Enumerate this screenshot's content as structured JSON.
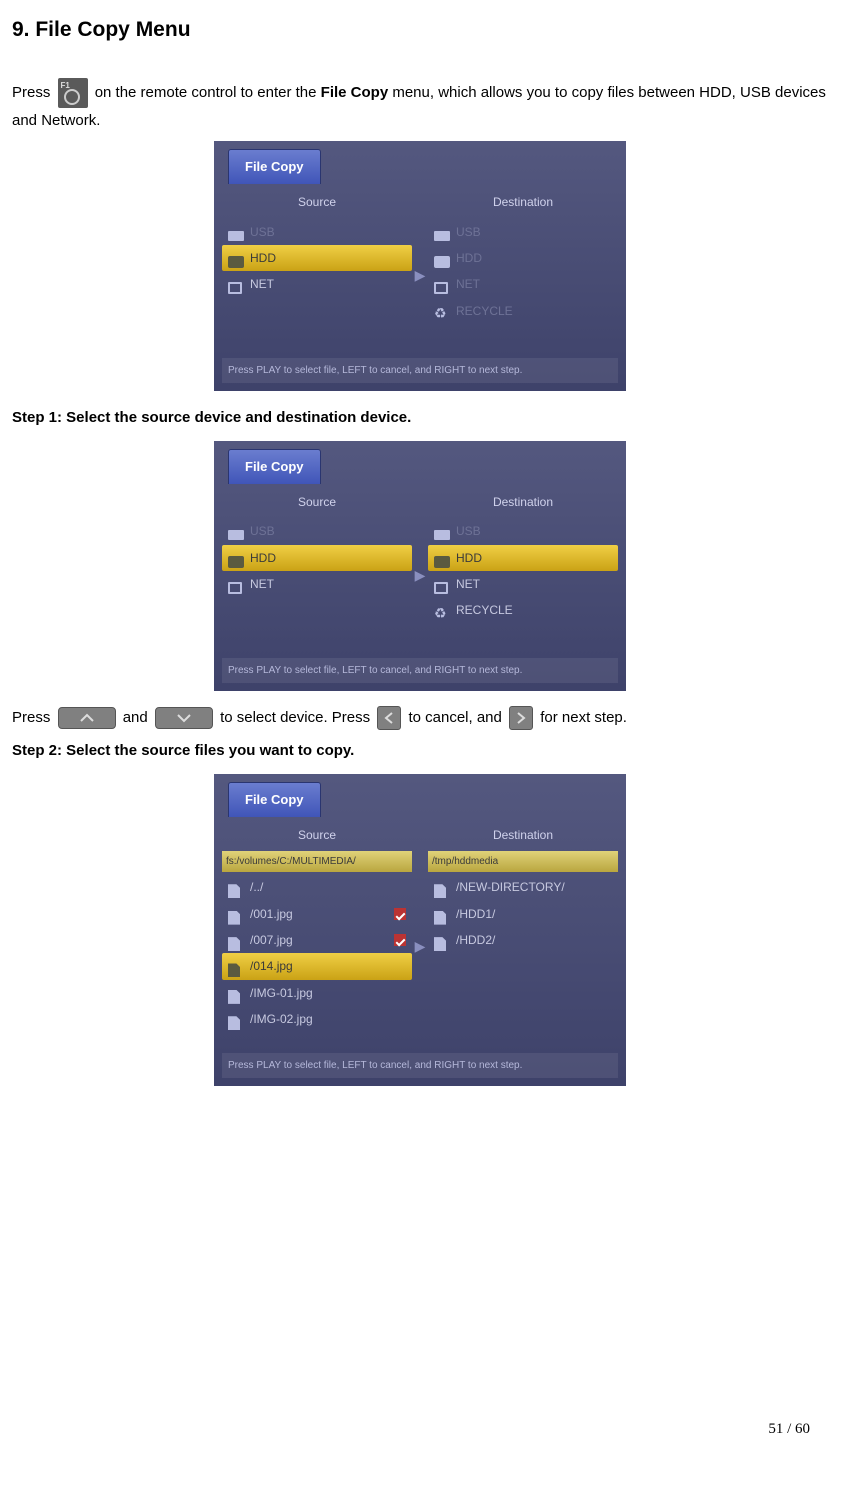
{
  "heading": "9. File Copy Menu",
  "intro": {
    "press": "Press ",
    "after_icon": " on the remote control to enter the ",
    "bold_menu": "File Copy",
    "tail": " menu, which allows you to copy files between HDD, USB devices and Network."
  },
  "shot_common": {
    "tab": "File Copy",
    "col_source": "Source",
    "col_dest": "Destination",
    "hint": "Press PLAY to select file, LEFT to cancel, and RIGHT to next step."
  },
  "shot1": {
    "source": [
      {
        "icon": "usb",
        "label": "USB",
        "dim": true
      },
      {
        "icon": "hdd",
        "label": "HDD",
        "hl": true
      },
      {
        "icon": "net",
        "label": "NET"
      }
    ],
    "dest": [
      {
        "icon": "usb",
        "label": "USB",
        "dim": true
      },
      {
        "icon": "hdd",
        "label": "HDD",
        "dim": true
      },
      {
        "icon": "net",
        "label": "NET",
        "dim": true
      },
      {
        "icon": "rec",
        "label": "RECYCLE",
        "dim": true
      }
    ]
  },
  "step1": "Step 1: Select the source device and destination device.",
  "shot2": {
    "source": [
      {
        "icon": "usb",
        "label": "USB",
        "dim": true
      },
      {
        "icon": "hdd",
        "label": "HDD",
        "hl": true
      },
      {
        "icon": "net",
        "label": "NET"
      }
    ],
    "dest": [
      {
        "icon": "usb",
        "label": "USB",
        "dim": true
      },
      {
        "icon": "hdd",
        "label": "HDD",
        "hl": true
      },
      {
        "icon": "net",
        "label": "NET"
      },
      {
        "icon": "rec",
        "label": "RECYCLE"
      }
    ]
  },
  "nav_line": {
    "a": "Press ",
    "b": " and ",
    "c": " to select device. Press ",
    "d": " to cancel, and ",
    "e": " for next step."
  },
  "step2": "Step 2: Select the source files you want to copy.",
  "shot3": {
    "src_path": "fs:/volumes/C:/MULTIMEDIA/",
    "dst_path": "/tmp/hddmedia",
    "source": [
      {
        "icon": "file",
        "label": "/../"
      },
      {
        "icon": "file",
        "label": "/001.jpg",
        "chk": true
      },
      {
        "icon": "file",
        "label": "/007.jpg",
        "chk": true
      },
      {
        "icon": "file",
        "label": "/014.jpg",
        "hl": true
      },
      {
        "icon": "file",
        "label": "/IMG-01.jpg"
      },
      {
        "icon": "file",
        "label": "/IMG-02.jpg"
      }
    ],
    "dest": [
      {
        "icon": "file",
        "label": "/NEW-DIRECTORY/"
      },
      {
        "icon": "file",
        "label": "/HDD1/"
      },
      {
        "icon": "file",
        "label": "/HDD2/"
      }
    ]
  },
  "page_number": "51 / 60"
}
